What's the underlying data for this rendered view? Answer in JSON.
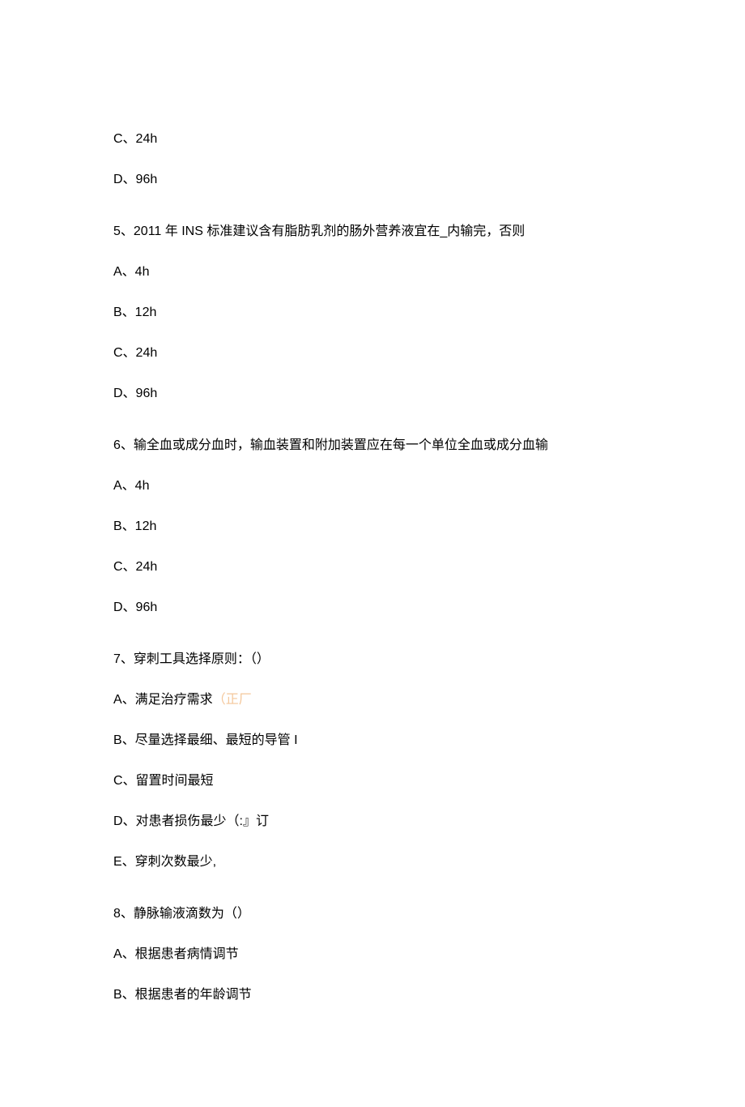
{
  "q4_trailing": {
    "optC": "C、24h",
    "optD": "D、96h"
  },
  "q5": {
    "stem": "5、2011 年 INS 标准建议含有脂肪乳剂的肠外营养液宜在_内输完，否则",
    "optA": "A、4h",
    "optB": "B、12h",
    "optC": "C、24h",
    "optD": "D、96h"
  },
  "q6": {
    "stem": "6、输全血或成分血时，输血装置和附加装置应在每一个单位全血或成分血输",
    "optA": "A、4h",
    "optB": "B、12h",
    "optC": "C、24h",
    "optD": "D、96h"
  },
  "q7": {
    "stem": "7、穿刺工具选择原则：（）",
    "optA_prefix": "A、满足治疗需求",
    "optA_annot": "（正厂",
    "optB": "B、尽量选择最细、最短的导管 I",
    "optC": "C、留置时间最短",
    "optD": "D、对患者损伤最少（:』订",
    "optE": "E、穿刺次数最少,"
  },
  "q8": {
    "stem": "8、静脉输液滴数为（）",
    "optA": "A、根据患者病情调节",
    "optB": "B、根据患者的年龄调节"
  }
}
